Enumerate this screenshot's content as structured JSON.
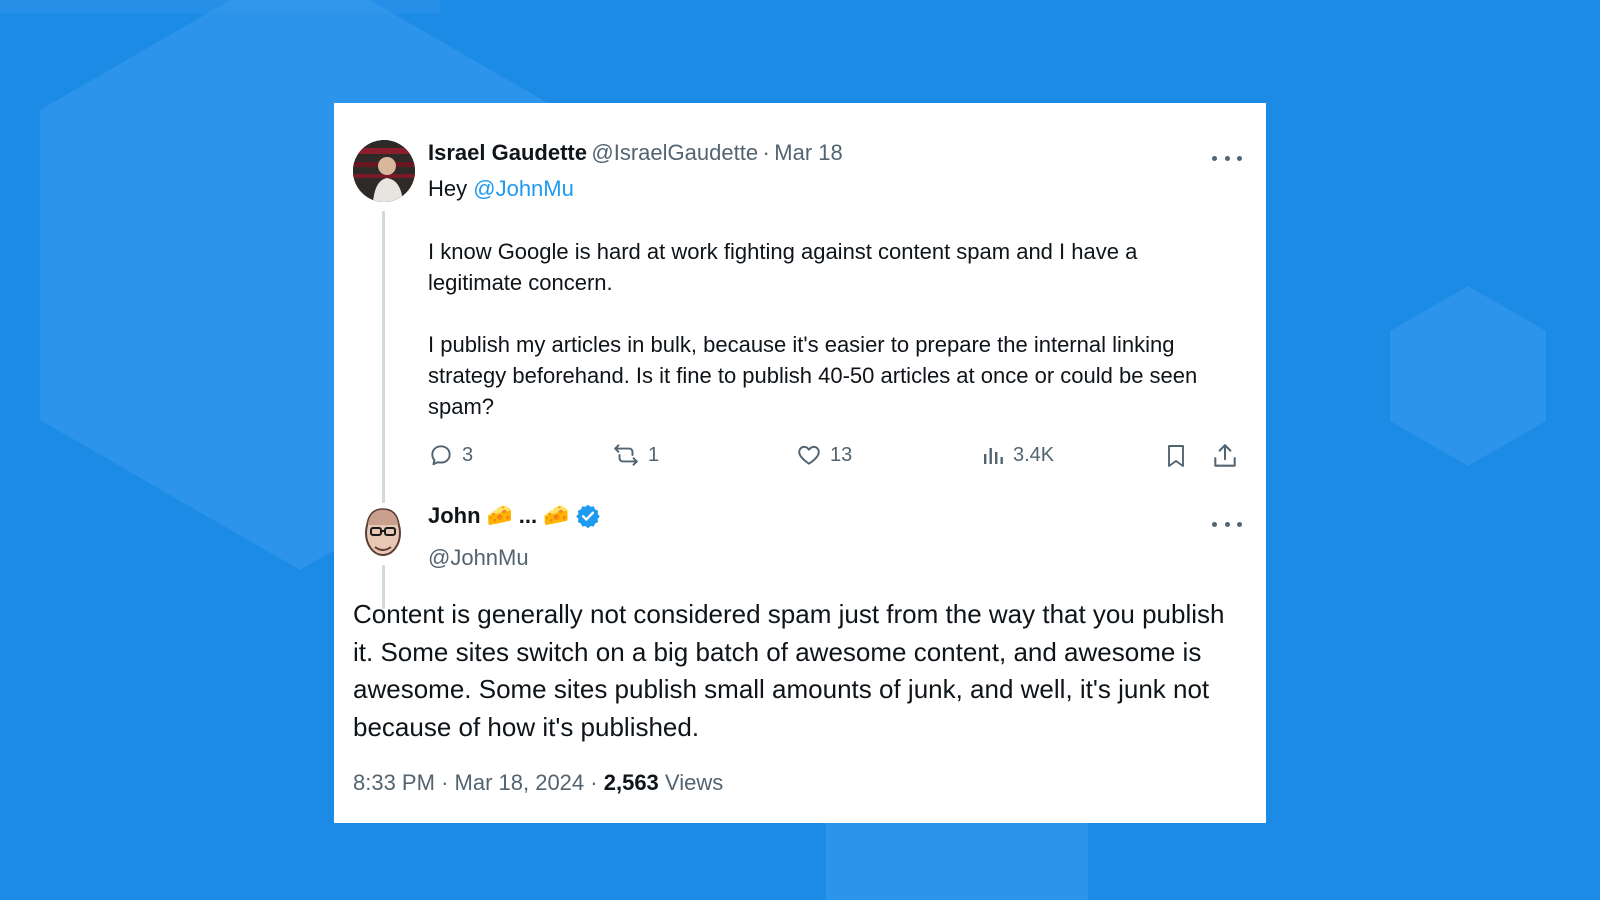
{
  "colors": {
    "background": "#1c8be6",
    "card": "#ffffff",
    "link": "#1d9bf0",
    "muted": "#536471",
    "verified": "#1d9bf0"
  },
  "original_tweet": {
    "author_name": "Israel Gaudette",
    "handle": "@IsraelGaudette",
    "separator": "·",
    "date": "Mar 18",
    "greeting": "Hey",
    "mention": "@JohnMu",
    "paragraph_1": "I know Google is hard at work fighting against content spam and I have a legitimate concern.",
    "paragraph_2": "I publish my articles in bulk, because it's easier to prepare the internal linking strategy beforehand. Is it fine to publish 40-50 articles at once or could be seen spam?",
    "stats": {
      "replies": "3",
      "reposts": "1",
      "likes": "13",
      "views": "3.4K"
    },
    "icons": [
      "reply-icon",
      "repost-icon",
      "like-icon",
      "views-icon",
      "bookmark-icon",
      "share-icon"
    ]
  },
  "reply_tweet": {
    "author_name": "John",
    "name_emoji_1": "🧀",
    "name_ellipsis": "...",
    "name_emoji_2": "🧀",
    "verified": true,
    "handle": "@JohnMu",
    "text": "Content is generally not considered spam just from the way that you publish it. Some sites switch on a big batch of awesome content, and awesome is awesome. Some sites publish small amounts of junk, and well, it's junk not because of how it's published.",
    "time": "8:33 PM",
    "separator": "·",
    "date": "Mar 18, 2024",
    "views_count": "2,563",
    "views_label": "Views"
  }
}
